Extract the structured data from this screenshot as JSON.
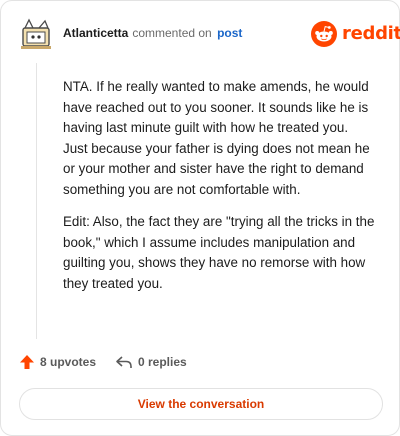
{
  "comment": {
    "author": "Atlanticetta",
    "action_text": "commented on",
    "post_link": "post",
    "paragraphs": [
      "NTA. If he really wanted to make amends, he would have reached out to you sooner. It sounds like he is having last minute guilt with how he treated you.\nJust because your father is dying does not mean he or your mother and sister have the right to demand something you are not comfortable with.",
      "Edit: Also, the fact they are \"trying all the tricks in the book,\" which I assume includes manipulation and guilting you, shows they have no remorse with how they treated you."
    ]
  },
  "brand": {
    "name": "reddit",
    "color": "#ff4500"
  },
  "actions": {
    "upvotes": "8 upvotes",
    "replies": "0 replies"
  },
  "footer": {
    "button_label": "View the conversation"
  },
  "colors": {
    "accent": "#ff4500",
    "link": "#1a66c9",
    "button_text": "#d93a00"
  },
  "icons": [
    "avatar",
    "reddit-logo-icon",
    "upvote-arrow-icon",
    "reply-icon"
  ]
}
